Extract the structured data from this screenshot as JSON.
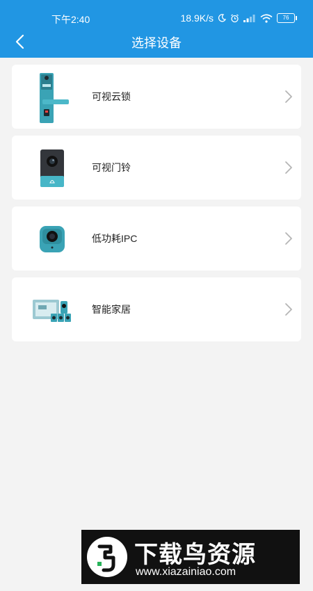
{
  "status_bar": {
    "time": "下午2:40",
    "net_speed": "18.9K/s",
    "battery": "76"
  },
  "header": {
    "title": "选择设备",
    "back_icon": "chevron-left-icon"
  },
  "devices": [
    {
      "label": "可视云锁",
      "icon": "smart-lock-icon"
    },
    {
      "label": "可视门铃",
      "icon": "doorbell-icon"
    },
    {
      "label": "低功耗IPC",
      "icon": "camera-icon"
    },
    {
      "label": "智能家居",
      "icon": "smart-home-icon"
    }
  ],
  "watermark": {
    "title": "下载鸟资源",
    "url": "www.xiazainiao.com"
  },
  "colors": {
    "header": "#2196e3",
    "background": "#f3f3f3",
    "device_accent": "#3aa3b5"
  }
}
